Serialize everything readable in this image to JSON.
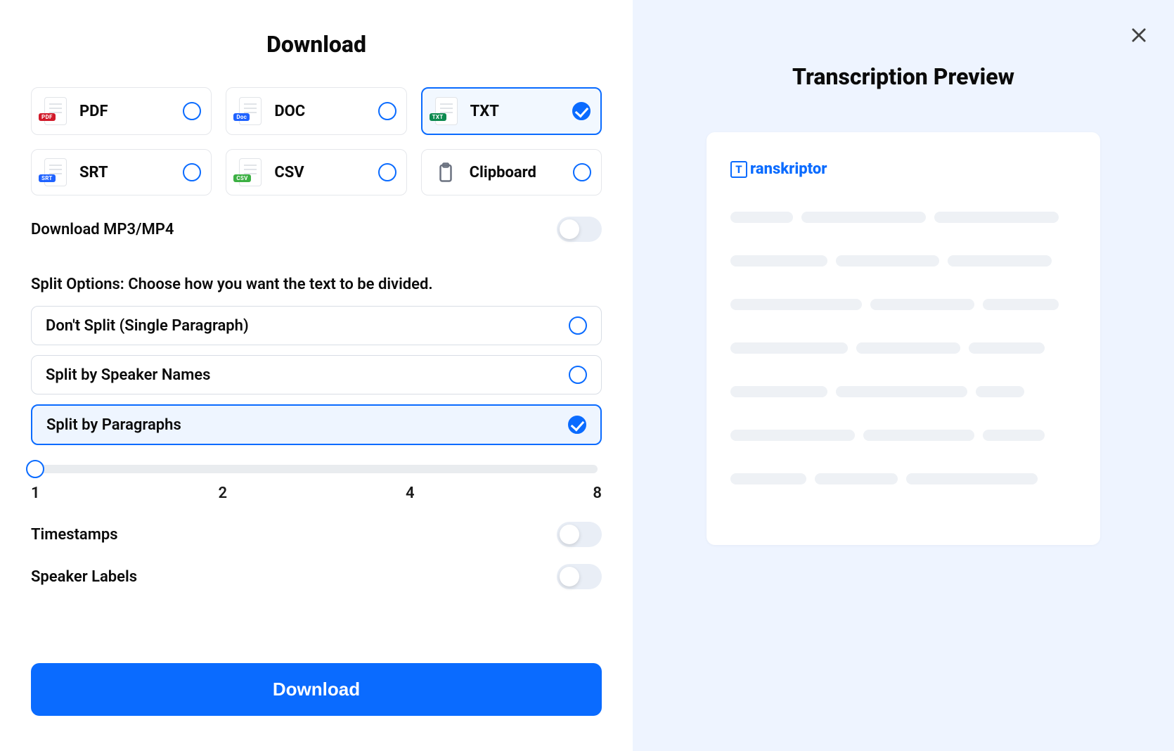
{
  "dialog": {
    "title": "Download",
    "download_button": "Download"
  },
  "formats": [
    {
      "id": "pdf",
      "label": "PDF",
      "tag": "PDF",
      "tagClass": "pdf",
      "selected": false,
      "kind": "file"
    },
    {
      "id": "doc",
      "label": "DOC",
      "tag": "Doc",
      "tagClass": "doc",
      "selected": false,
      "kind": "file"
    },
    {
      "id": "txt",
      "label": "TXT",
      "tag": "TXT",
      "tagClass": "txt",
      "selected": true,
      "kind": "file"
    },
    {
      "id": "srt",
      "label": "SRT",
      "tag": "SRT",
      "tagClass": "srt",
      "selected": false,
      "kind": "file"
    },
    {
      "id": "csv",
      "label": "CSV",
      "tag": "CSV",
      "tagClass": "csv",
      "selected": false,
      "kind": "file"
    },
    {
      "id": "clipboard",
      "label": "Clipboard",
      "tag": "",
      "tagClass": "",
      "selected": false,
      "kind": "clipboard"
    }
  ],
  "toggles": {
    "mp3mp4": {
      "label": "Download MP3/MP4",
      "on": false
    },
    "timestamps": {
      "label": "Timestamps",
      "on": false
    },
    "speakers": {
      "label": "Speaker Labels",
      "on": false
    }
  },
  "split": {
    "section_label": "Split Options: Choose how you want the text to be divided.",
    "options": [
      {
        "id": "none",
        "label": "Don't Split (Single Paragraph)",
        "selected": false
      },
      {
        "id": "speaker",
        "label": "Split by Speaker Names",
        "selected": false
      },
      {
        "id": "para",
        "label": "Split by Paragraphs",
        "selected": true
      }
    ]
  },
  "slider": {
    "min": 1,
    "max": 8,
    "value": 1,
    "ticks": [
      "1",
      "2",
      "4",
      "8"
    ]
  },
  "preview": {
    "title": "Transcription Preview",
    "brand": "ranskriptor"
  }
}
